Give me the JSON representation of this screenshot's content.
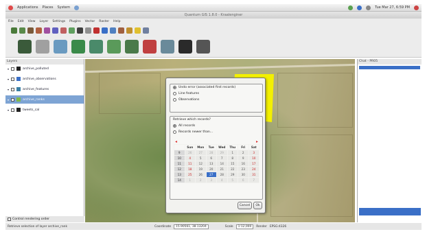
{
  "system_panel": {
    "menus": [
      "Applications",
      "Places",
      "System"
    ],
    "clock": "Tue Mar 27, 6:59 PM"
  },
  "window": {
    "title": "Quantum GIS 1.8.0 - Kraalenginer"
  },
  "menubar": [
    "File",
    "Edit",
    "View",
    "Layer",
    "Settings",
    "Plugins",
    "Vector",
    "Raster",
    "Help"
  ],
  "layers_panel": {
    "title": "Layers",
    "items": [
      {
        "label": "archive_polluted",
        "symbol_color": "#222222",
        "selected": false
      },
      {
        "label": "archive_observations",
        "symbol_color": "#3a6fc7",
        "selected": false
      },
      {
        "label": "archive_features",
        "symbol_color": "#3a7fa5",
        "selected": false
      },
      {
        "label": "archive_ranks",
        "symbol_color": "#7fb84a",
        "selected": true
      },
      {
        "label": "tweets_cal",
        "symbol_color": "#222222",
        "selected": false
      }
    ],
    "footer": "Control rendering order"
  },
  "chat_panel": {
    "title": "Chat - PR05"
  },
  "statusbar": {
    "left": "Retrieve selection of layer archive_rank",
    "coordinate_label": "Coordinate",
    "coordinate": "15.90561, 38.13204",
    "scale_label": "Scale",
    "scale": "1:12,000",
    "render_label": "Render",
    "crs": "EPSG:4326"
  },
  "dialog": {
    "layer_options": [
      {
        "label": "Undo error (associated first records)",
        "checked": true
      },
      {
        "label": "Line features",
        "checked": false
      },
      {
        "label": "Observations",
        "checked": false
      }
    ],
    "retrieve_label": "Retrieve which records?",
    "record_options": [
      {
        "label": "All records",
        "checked": true
      },
      {
        "label": "Records newer than...",
        "checked": false
      }
    ],
    "calendar": {
      "weekdays": [
        "",
        "Sun",
        "Mon",
        "Tue",
        "Wed",
        "Thu",
        "Fri",
        "Sat"
      ],
      "weeks": [
        {
          "wk": "9",
          "days": [
            "26",
            "27",
            "28",
            "29",
            "1",
            "2",
            "3"
          ]
        },
        {
          "wk": "10",
          "days": [
            "4",
            "5",
            "6",
            "7",
            "8",
            "9",
            "10"
          ]
        },
        {
          "wk": "11",
          "days": [
            "11",
            "12",
            "13",
            "14",
            "15",
            "16",
            "17"
          ]
        },
        {
          "wk": "12",
          "days": [
            "18",
            "19",
            "20",
            "21",
            "22",
            "23",
            "24"
          ]
        },
        {
          "wk": "13",
          "days": [
            "25",
            "26",
            "27",
            "28",
            "29",
            "30",
            "31"
          ]
        },
        {
          "wk": "14",
          "days": [
            "1",
            "2",
            "3",
            "4",
            "5",
            "6",
            "7"
          ]
        }
      ],
      "selected_day": "27"
    },
    "cancel_label": "Cancel",
    "ok_label": "Ok"
  },
  "colors": {
    "selection_blue": "#3a6fc7",
    "polygon_yellow": "#f3f000"
  }
}
